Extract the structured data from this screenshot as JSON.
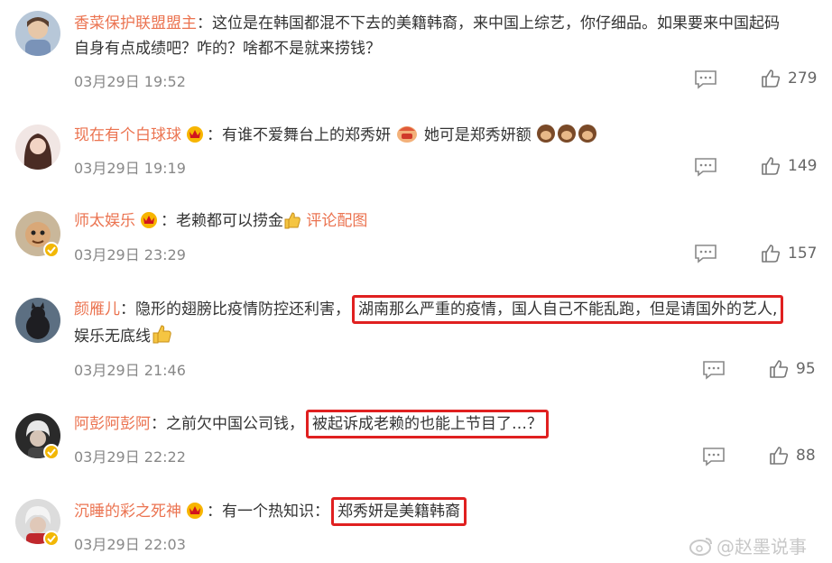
{
  "comments": [
    {
      "username": "香菜保护联盟盟主",
      "text_line1": "：这位是在韩国都混不下去的美籍韩裔，来中国上综艺，你仔细品。如果要来中国起码",
      "text_line2": "自身有点成绩吧？咋的？啥都不是就来捞钱？",
      "timestamp": "03月29日 19:52",
      "likes": "279"
    },
    {
      "username": "现在有个白球球",
      "text_part1": "：有谁不爱舞台上的郑秀妍",
      "text_part2": "她可是郑秀妍额",
      "timestamp": "03月29日 19:19",
      "likes": "149"
    },
    {
      "username": "师太娱乐",
      "text": "：老赖都可以捞金",
      "link": "评论配图",
      "timestamp": "03月29日 23:29",
      "likes": "157"
    },
    {
      "username": "颜雁儿",
      "text_before": "：隐形的翅膀比疫情防控还利害，",
      "highlight": "湖南那么严重的疫情，国人自己不能乱跑，但是请国外的艺人,",
      "text_line2": "娱乐无底线",
      "timestamp": "03月29日 21:46",
      "likes": "95"
    },
    {
      "username": "阿彭阿彭阿",
      "text_before": "：之前欠中国公司钱，",
      "highlight": "被起诉成老赖的也能上节目了…？",
      "timestamp": "03月29日 22:22",
      "likes": "88"
    },
    {
      "username": "沉睡的彩之死神",
      "text_before": "：有一个热知识：",
      "highlight": "郑秀妍是美籍韩裔",
      "timestamp": "03月29日 22:03"
    }
  ],
  "watermark": "@赵墨说事",
  "colors": {
    "username": "#eb7350",
    "highlight_border": "#e02020",
    "badge": "#f2b705"
  }
}
